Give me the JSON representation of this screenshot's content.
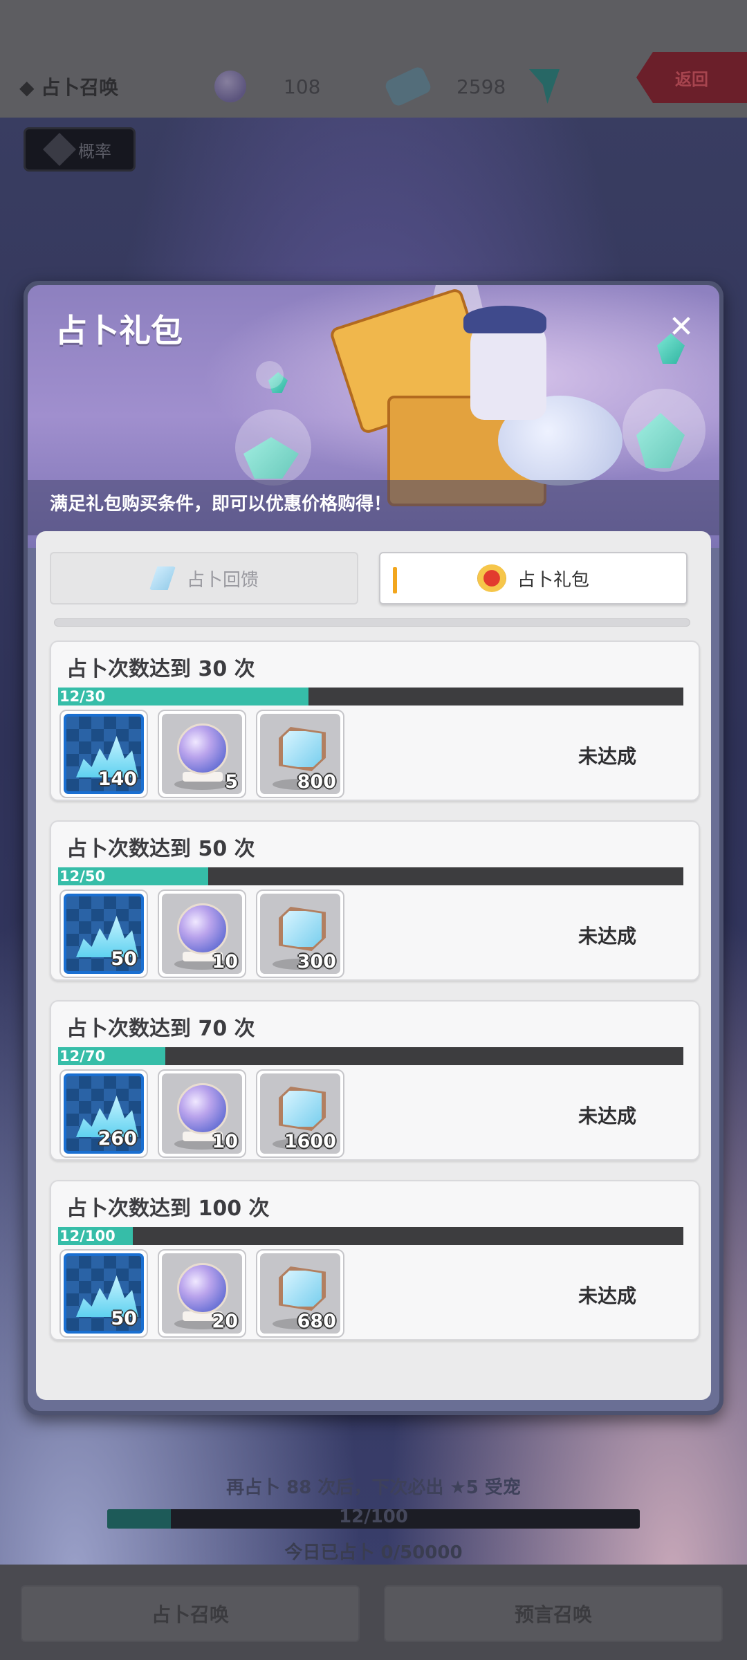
{
  "background": {
    "page_title": "◆ 占卜召唤",
    "orb_count": "108",
    "gem_count": "2598",
    "back_label": "返回",
    "probability_label": "概率",
    "next_hint": "再占卜 88 次后，下次必出 ★5 受宠",
    "pity_progress": {
      "label": "12/100",
      "current": 12,
      "max": 100
    },
    "today_text": "今日已占卜 0/50000",
    "tabs": [
      "占卜召唤",
      "预言召唤"
    ]
  },
  "modal": {
    "title": "占卜礼包",
    "subtitle": "满足礼包购买条件，即可以优惠价格购得！",
    "tabs": {
      "feedback": "占卜回馈",
      "gift": "占卜礼包"
    },
    "milestones": [
      {
        "title": "占卜次数达到 30 次",
        "progress_label": "12/30",
        "current": 12,
        "target": 30,
        "rewards": {
          "crystals": "140",
          "orbs": "5",
          "gems": "800"
        },
        "status": "未达成"
      },
      {
        "title": "占卜次数达到 50 次",
        "progress_label": "12/50",
        "current": 12,
        "target": 50,
        "rewards": {
          "crystals": "50",
          "orbs": "10",
          "gems": "300"
        },
        "status": "未达成"
      },
      {
        "title": "占卜次数达到 70 次",
        "progress_label": "12/70",
        "current": 12,
        "target": 70,
        "rewards": {
          "crystals": "260",
          "orbs": "10",
          "gems": "1600"
        },
        "status": "未达成"
      },
      {
        "title": "占卜次数达到 100 次",
        "progress_label": "12/100",
        "current": 12,
        "target": 100,
        "rewards": {
          "crystals": "50",
          "orbs": "20",
          "gems": "680"
        },
        "status": "未达成"
      }
    ]
  },
  "colors": {
    "progress_fill": "#36bda8",
    "progress_track": "#3d3d3f",
    "tab_accent": "#f2a61d",
    "reward_blue": "#1a6fd1"
  }
}
